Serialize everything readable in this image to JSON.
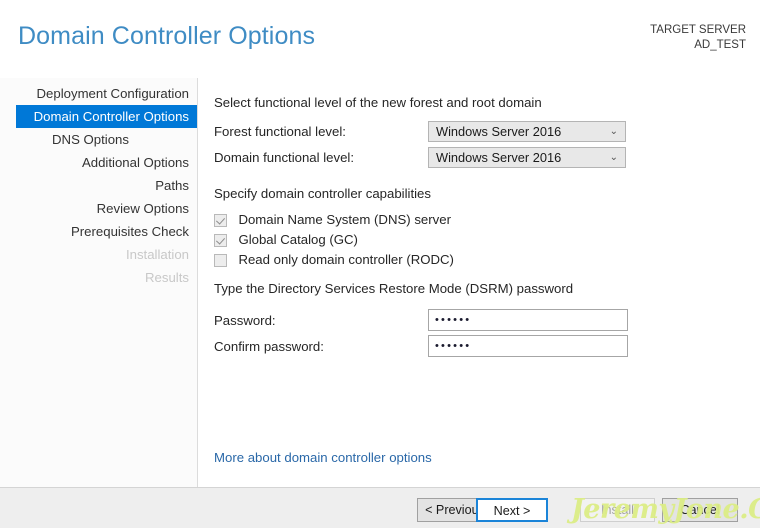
{
  "header": {
    "title": "Domain Controller Options",
    "target_server_label": "TARGET SERVER",
    "target_server_name": "AD_TEST"
  },
  "sidebar": {
    "items": [
      {
        "label": "Deployment Configuration",
        "state": "normal"
      },
      {
        "label": "Domain Controller Options",
        "state": "selected"
      },
      {
        "label": "DNS Options",
        "state": "indent"
      },
      {
        "label": "Additional Options",
        "state": "normal"
      },
      {
        "label": "Paths",
        "state": "normal"
      },
      {
        "label": "Review Options",
        "state": "normal"
      },
      {
        "label": "Prerequisites Check",
        "state": "normal"
      },
      {
        "label": "Installation",
        "state": "disabled"
      },
      {
        "label": "Results",
        "state": "disabled"
      }
    ]
  },
  "main": {
    "functional_level_heading": "Select functional level of the new forest and root domain",
    "forest_level_label": "Forest functional level:",
    "forest_level_value": "Windows Server 2016",
    "domain_level_label": "Domain functional level:",
    "domain_level_value": "Windows Server 2016",
    "capabilities_heading": "Specify domain controller capabilities",
    "capabilities": [
      {
        "label": "Domain Name System (DNS) server",
        "checked": true
      },
      {
        "label": "Global Catalog (GC)",
        "checked": true
      },
      {
        "label": "Read only domain controller (RODC)",
        "checked": false
      }
    ],
    "dsrm_heading": "Type the Directory Services Restore Mode (DSRM) password",
    "password_label": "Password:",
    "password_value": "••••••",
    "confirm_label": "Confirm password:",
    "confirm_value": "••••••",
    "more_link": "More about domain controller options",
    "chevron": "⌄"
  },
  "footer": {
    "previous": "< Previous",
    "next": "Next >",
    "install": "Install",
    "cancel": "Cancel"
  },
  "watermark": {
    "text": "JeremyJone.COM"
  },
  "colors": {
    "accent_blue": "#0078d7",
    "title_blue": "#3f8cc4",
    "link_blue": "#2a68a8",
    "watermark_green": "#dced86"
  }
}
